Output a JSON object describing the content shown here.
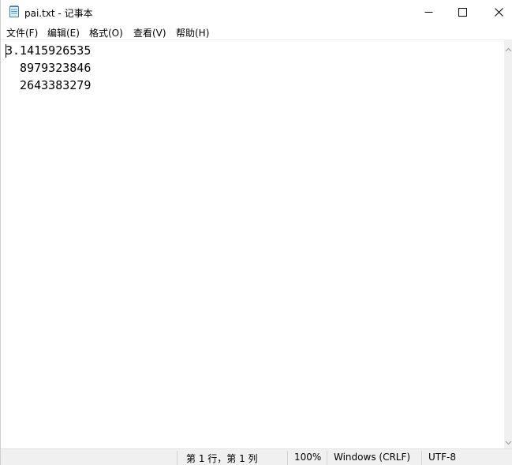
{
  "window": {
    "title": "pai.txt - 记事本",
    "icon": "notepad-icon"
  },
  "caption_buttons": {
    "minimize": "minimize-icon",
    "maximize": "maximize-icon",
    "close": "close-icon"
  },
  "menu": {
    "items": [
      {
        "label": "文件(F)"
      },
      {
        "label": "编辑(E)"
      },
      {
        "label": "格式(O)"
      },
      {
        "label": "查看(V)"
      },
      {
        "label": "帮助(H)"
      }
    ]
  },
  "editor": {
    "lines": [
      "3.1415926535",
      "  8979323846",
      "  2643383279"
    ]
  },
  "statusbar": {
    "position": "第 1 行，第 1 列",
    "zoom": "100%",
    "line_ending": "Windows (CRLF)",
    "encoding": "UTF-8"
  }
}
